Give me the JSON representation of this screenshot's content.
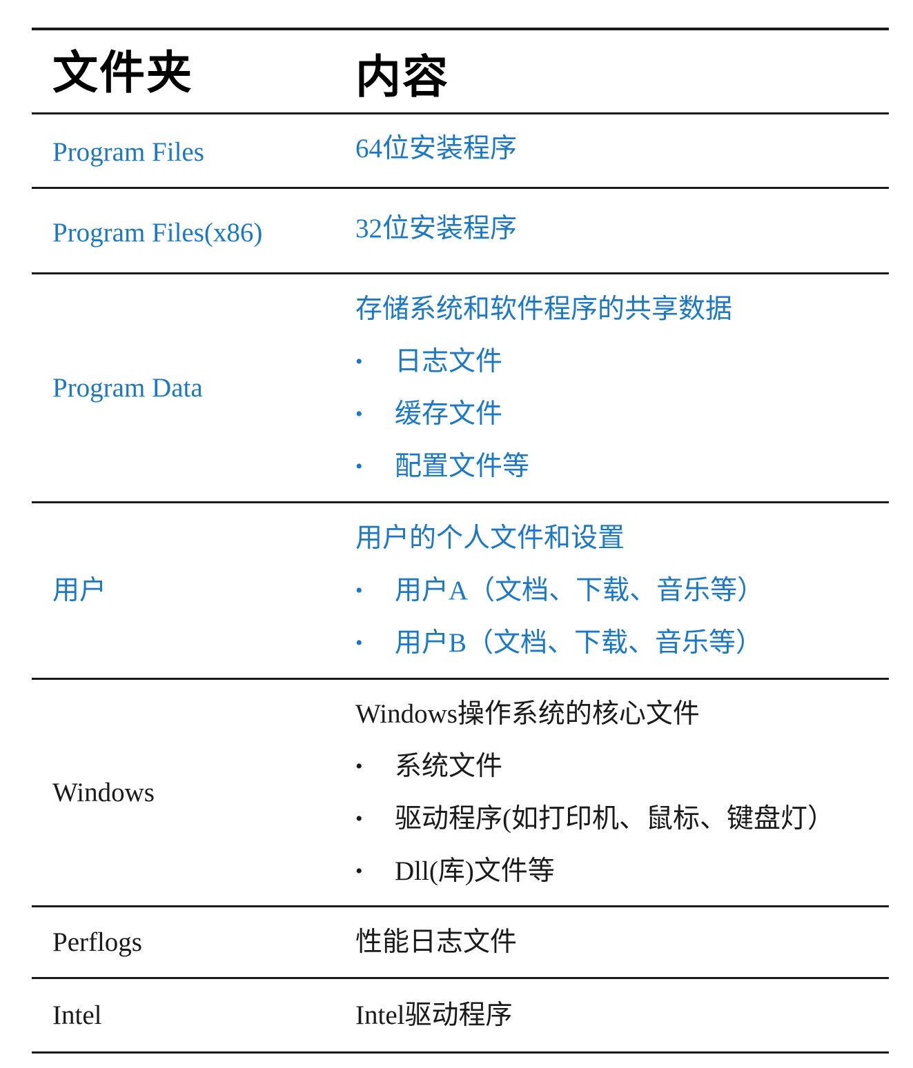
{
  "header": {
    "folder": "文件夹",
    "content": "内容"
  },
  "rows": [
    {
      "folder": "Program Files",
      "content": "64位安装程序"
    },
    {
      "folder": "Program Files(x86)",
      "content": "32位安装程序"
    },
    {
      "folder": "Program Data",
      "content": "存储系统和软件程序的共享数据",
      "bullets": [
        "日志文件",
        "缓存文件",
        "配置文件等"
      ]
    },
    {
      "folder": "用户",
      "content": "用户的个人文件和设置",
      "bullets": [
        "用户A（文档、下载、音乐等）",
        "用户B（文档、下载、音乐等）"
      ]
    },
    {
      "folder": "Windows",
      "content": "Windows操作系统的核心文件",
      "bullets": [
        "系统文件",
        "驱动程序(如打印机、鼠标、键盘灯）",
        "Dll(库)文件等"
      ]
    },
    {
      "folder": "Perflogs",
      "content": "性能日志文件"
    },
    {
      "folder": "Intel",
      "content": "Intel驱动程序"
    }
  ],
  "bullet_char": "•",
  "colors": {
    "blue_text": "#1a78c8",
    "black_text": "#1a1a1a",
    "rule": "#1a1a1a"
  }
}
